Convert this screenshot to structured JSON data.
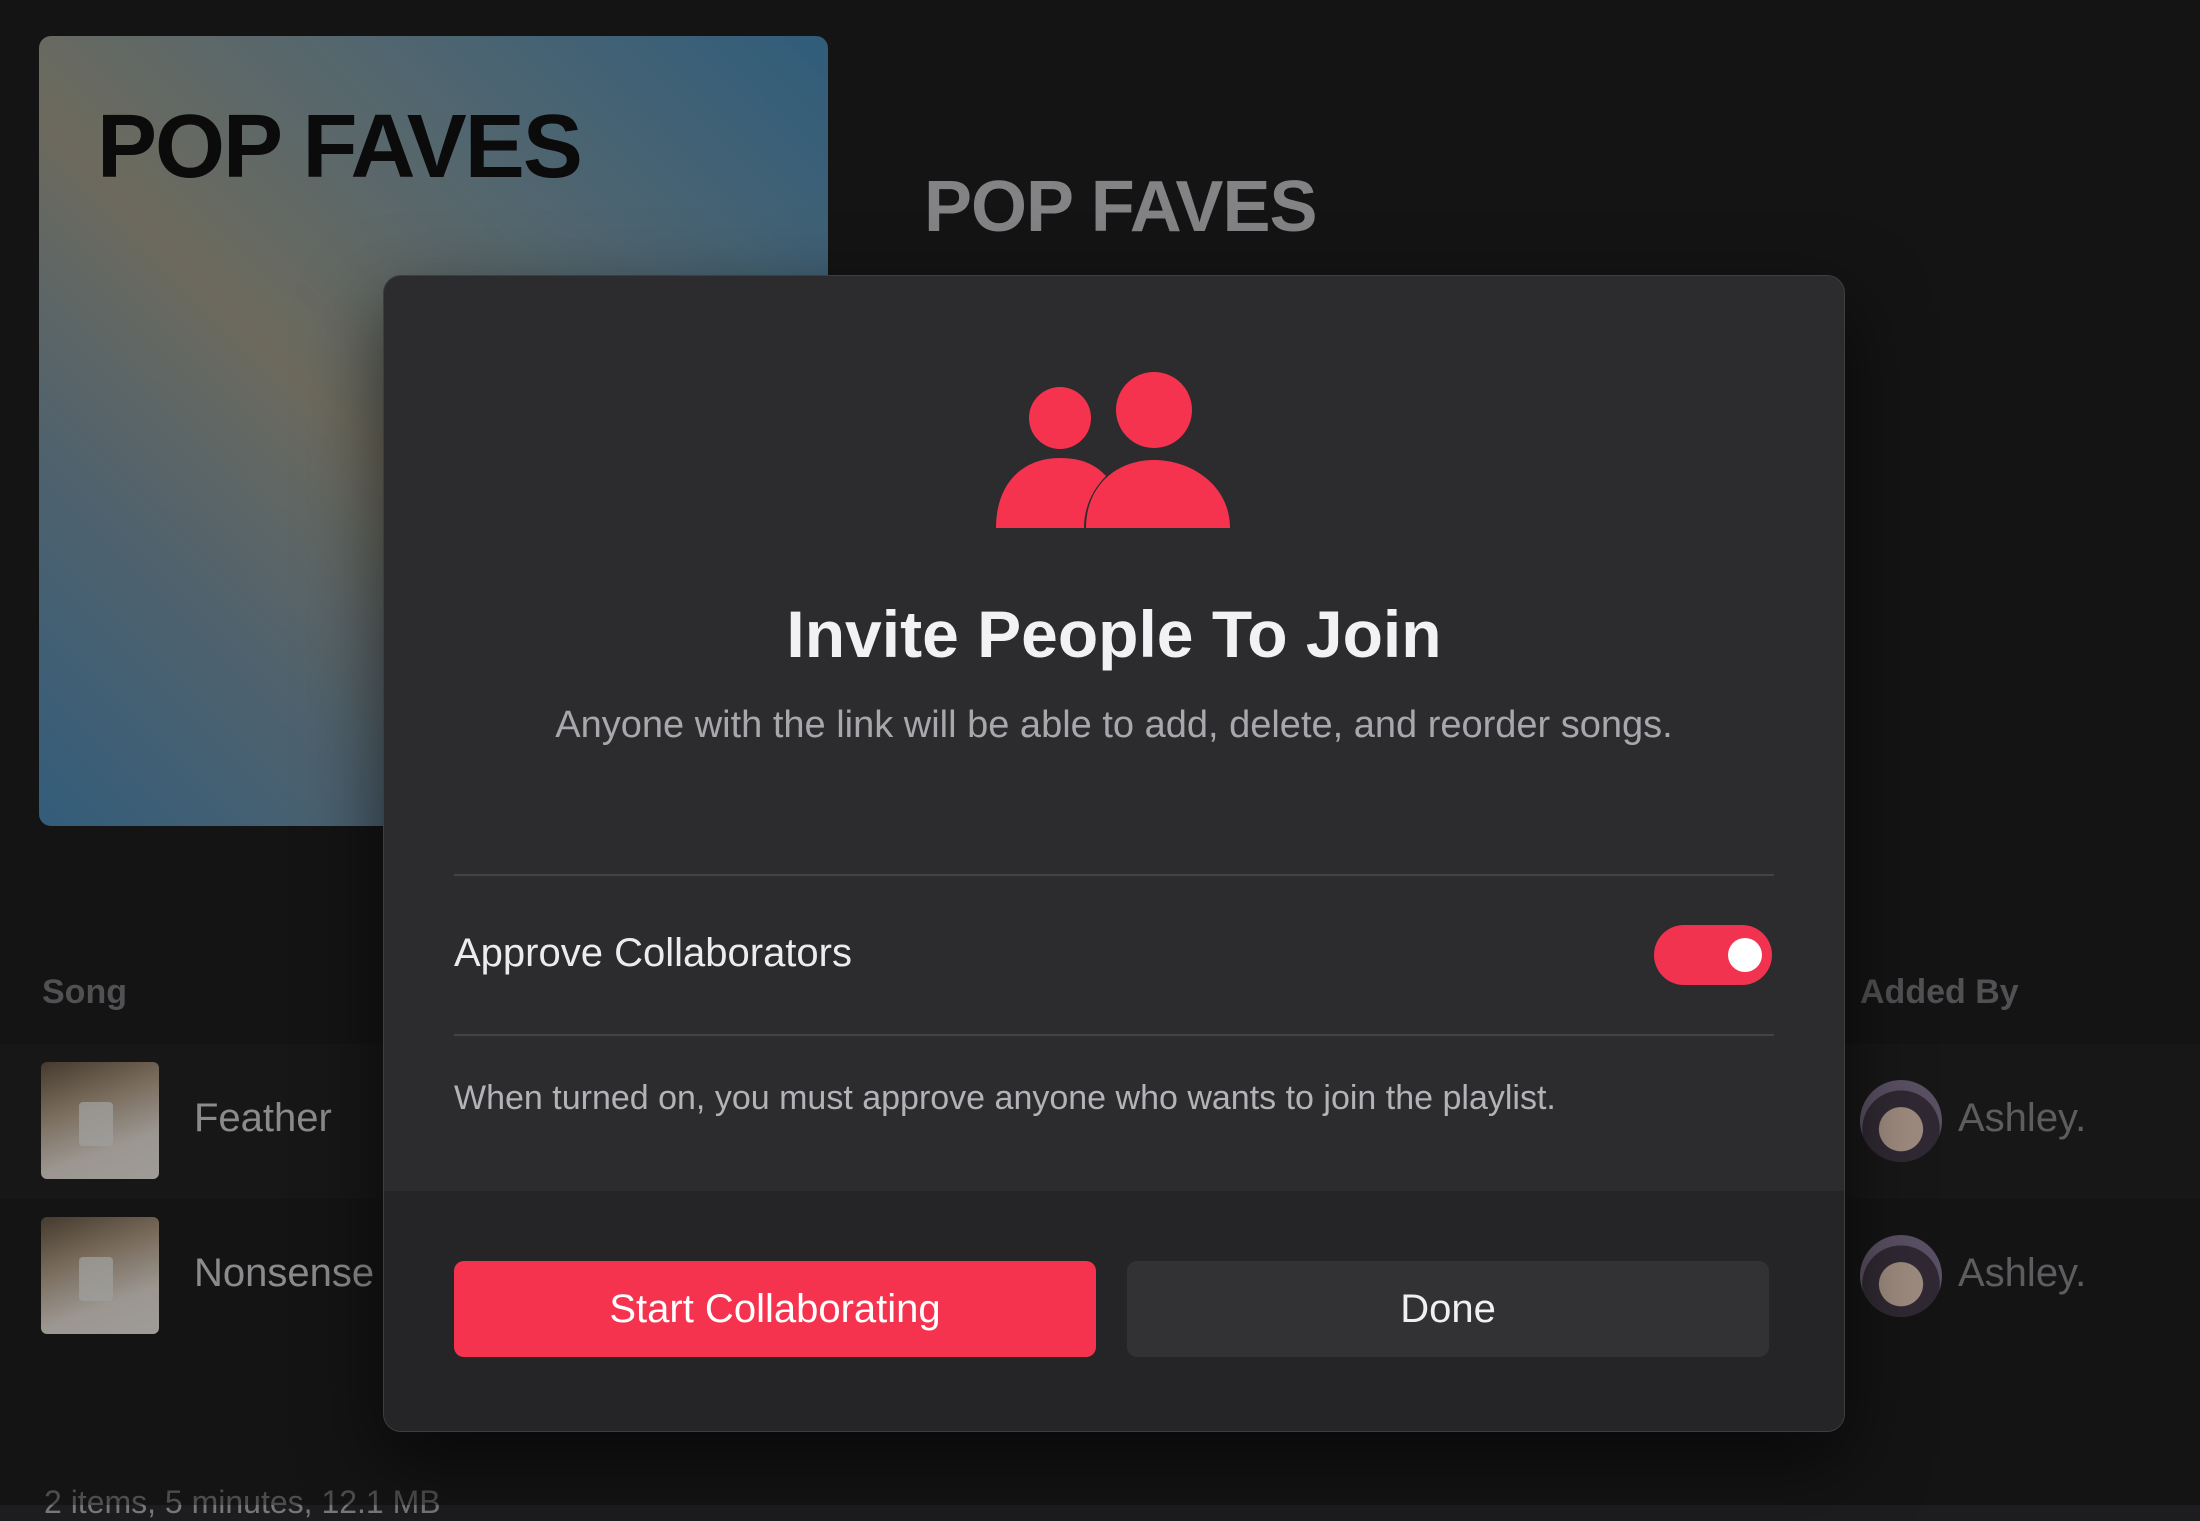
{
  "playlist": {
    "artwork_title": "POP FAVES",
    "title": "POP FAVES"
  },
  "table": {
    "columns": [
      "Song",
      "Added By"
    ],
    "rows": [
      {
        "title": "Feather",
        "added_by": "Ashley."
      },
      {
        "title": "Nonsense",
        "added_by": "Ashley."
      }
    ]
  },
  "footer": {
    "summary": "2 items, 5 minutes, 12.1 MB"
  },
  "dialog": {
    "icon": "people-icon",
    "title": "Invite People To Join",
    "subtitle": "Anyone with the link will be able to add, delete, and reorder songs.",
    "option_label": "Approve Collaborators",
    "option_enabled": true,
    "hint": "When turned on, you must approve anyone who wants to join the playlist.",
    "primary_button": "Start Collaborating",
    "secondary_button": "Done"
  },
  "colors": {
    "accent": "#f6334f",
    "dialog_bg": "#2c2c2e",
    "page_bg": "#1f1f21"
  }
}
